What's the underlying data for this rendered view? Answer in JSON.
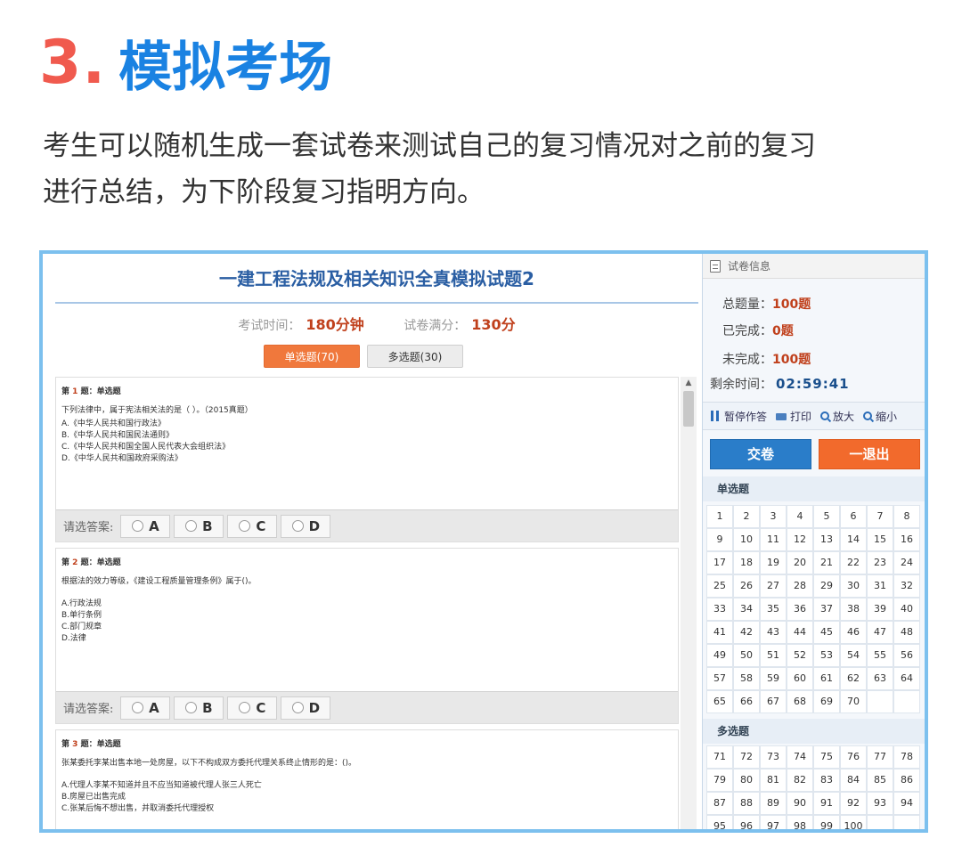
{
  "heading": {
    "number": "3.",
    "title": "模拟考场"
  },
  "intro": [
    "考生可以随机生成一套试卷来测试自己的复习情况对之前的复习",
    "进行总结，为下阶段复习指明方向。"
  ],
  "exam": {
    "title": "一建工程法规及相关知识全真模拟试题2",
    "time_label": "考试时间：",
    "time_value": "180分钟",
    "score_label": "试卷满分：",
    "score_value": "130分",
    "tabs": {
      "single": "单选题(70)",
      "multi": "多选题(30)"
    }
  },
  "answer_label": "请选答案:",
  "options": [
    "A",
    "B",
    "C",
    "D"
  ],
  "questions": [
    {
      "head_prefix": "第",
      "number": "1",
      "head_suffix": "题：单选题",
      "text": "下列法律中，属于宪法相关法的是（ ）。（2015真题）",
      "choices": [
        "A.《中华人民共和国行政法》",
        "B.《中华人民共和国民法通则》",
        "C.《中华人民共和国全国人民代表大会组织法》",
        "D.《中华人民共和国政府采购法》"
      ]
    },
    {
      "head_prefix": "第",
      "number": "2",
      "head_suffix": "题：单选题",
      "text": "根据法的效力等级，《建设工程质量管理条例》属于()。",
      "choices": [
        "A.行政法规",
        "B.单行条例",
        "C.部门规章",
        "D.法律"
      ]
    },
    {
      "head_prefix": "第",
      "number": "3",
      "head_suffix": "题：单选题",
      "text": "张某委托李某出售本地一处房屋，以下不构成双方委托代理关系终止情形的是：()。",
      "choices": [
        "A.代理人李某不知道并且不应当知道被代理人张三人死亡",
        "B.房屋已出售完成",
        "C.张某后悔不想出售，并取消委托代理授权"
      ]
    }
  ],
  "sidebar": {
    "info_title": "试卷信息",
    "total_label": "总题量：",
    "total_value": "100题",
    "done_label": "已完成：",
    "done_value": "0题",
    "undone_label": "未完成：",
    "undone_value": "100题",
    "remain_label": "剩余时间：",
    "remain_value": "02:59:41",
    "tools": {
      "pause": "暂停作答",
      "print": "打印",
      "zoom_in": "放大",
      "zoom_out": "缩小"
    },
    "submit": "交卷",
    "exit": "一退出",
    "single_label": "单选题",
    "multi_label": "多选题",
    "single_numbers": [
      "1",
      "2",
      "3",
      "4",
      "5",
      "6",
      "7",
      "8",
      "9",
      "10",
      "11",
      "12",
      "13",
      "14",
      "15",
      "16",
      "17",
      "18",
      "19",
      "20",
      "21",
      "22",
      "23",
      "24",
      "25",
      "26",
      "27",
      "28",
      "29",
      "30",
      "31",
      "32",
      "33",
      "34",
      "35",
      "36",
      "37",
      "38",
      "39",
      "40",
      "41",
      "42",
      "43",
      "44",
      "45",
      "46",
      "47",
      "48",
      "49",
      "50",
      "51",
      "52",
      "53",
      "54",
      "55",
      "56",
      "57",
      "58",
      "59",
      "60",
      "61",
      "62",
      "63",
      "64",
      "65",
      "66",
      "67",
      "68",
      "69",
      "70"
    ],
    "multi_numbers": [
      "71",
      "72",
      "73",
      "74",
      "75",
      "76",
      "77",
      "78",
      "79",
      "80",
      "81",
      "82",
      "83",
      "84",
      "85",
      "86",
      "87",
      "88",
      "89",
      "90",
      "91",
      "92",
      "93",
      "94",
      "95",
      "96",
      "97",
      "98",
      "99",
      "100"
    ]
  }
}
